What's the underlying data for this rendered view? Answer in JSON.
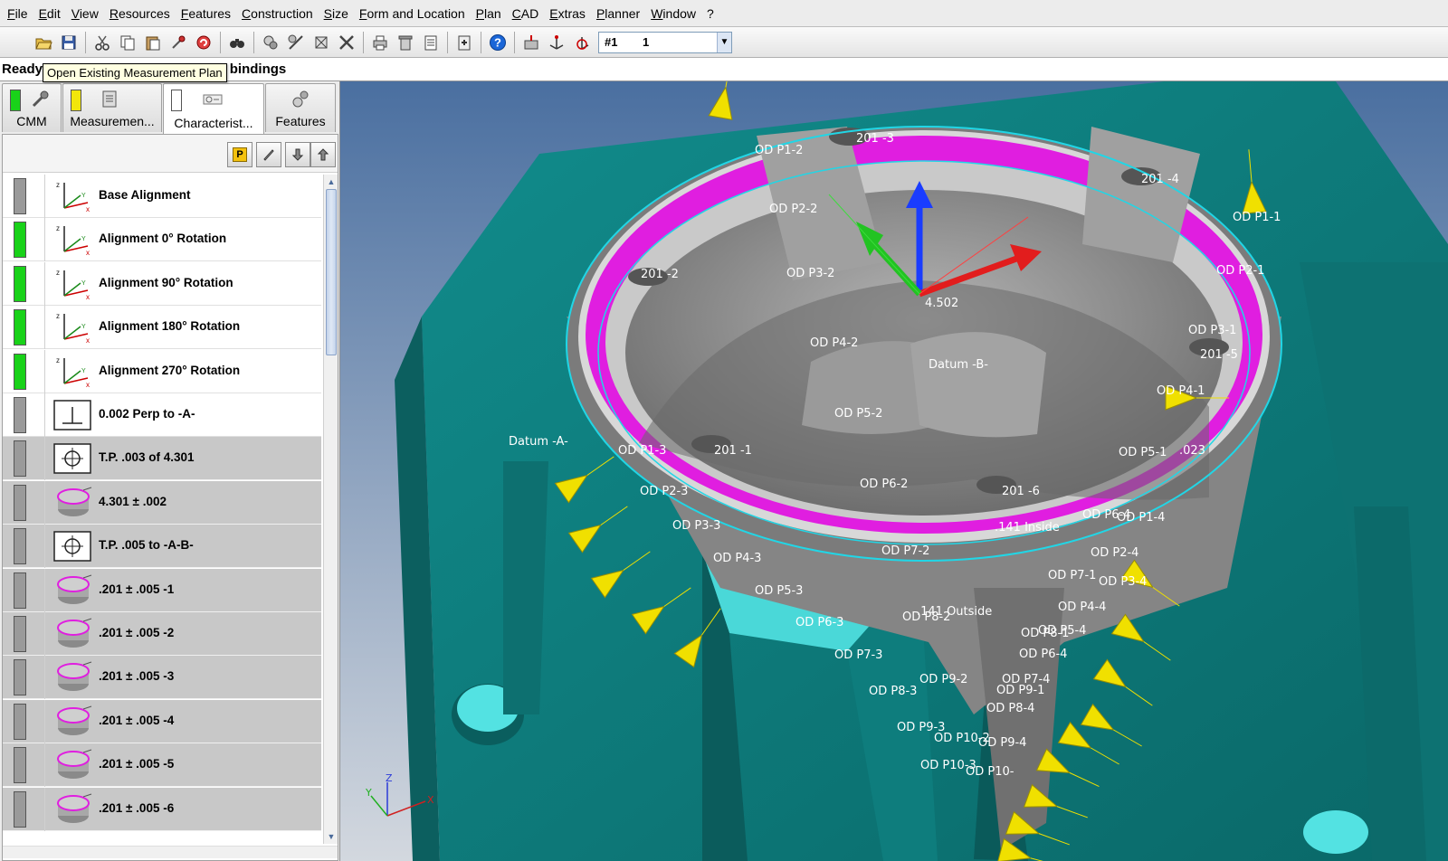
{
  "menu": [
    "File",
    "Edit",
    "View",
    "Resources",
    "Features",
    "Construction",
    "Size",
    "Form and Location",
    "Plan",
    "CAD",
    "Extras",
    "Planner",
    "Window",
    "?"
  ],
  "toolbar": {
    "icons": [
      "open-icon",
      "save-icon",
      "cut-icon",
      "copy-icon",
      "paste-icon",
      "probe-icon",
      "undo-icon",
      "find-icon",
      "feature-icon",
      "measure-icon",
      "construct-icon",
      "settings-icon",
      "print-icon",
      "delete-icon",
      "list-icon",
      "export-icon",
      "help-icon",
      "cmm-icon",
      "axis-icon",
      "rotate-icon"
    ],
    "plan_id": "#1",
    "plan_value": "1"
  },
  "status": {
    "text": "Ready  Make a selection in the plan bindings",
    "tooltip": "Open Existing Measurement Plan"
  },
  "tabs": [
    {
      "label": "CMM",
      "swatch": "#19d219"
    },
    {
      "label": "Measuremen...",
      "swatch": "#f2e60c"
    },
    {
      "label": "Characterist...",
      "swatch": "#ffffff"
    },
    {
      "label": "Features",
      "swatch": ""
    }
  ],
  "list_buttons": [
    "P",
    "pencil-icon",
    "arrow-down-icon",
    "arrow-up-icon"
  ],
  "characteristics": [
    {
      "label": "Base Alignment",
      "status": "#9a9a9a",
      "icon": "alignment-icon",
      "selected": false
    },
    {
      "label": "Alignment 0° Rotation",
      "status": "#19d219",
      "icon": "alignment-icon",
      "selected": false
    },
    {
      "label": "Alignment 90° Rotation",
      "status": "#19d219",
      "icon": "alignment-icon",
      "selected": false
    },
    {
      "label": "Alignment 180° Rotation",
      "status": "#19d219",
      "icon": "alignment-icon",
      "selected": false
    },
    {
      "label": "Alignment 270° Rotation",
      "status": "#19d219",
      "icon": "alignment-icon",
      "selected": false
    },
    {
      "label": "0.002 Perp to -A-",
      "status": "#9a9a9a",
      "icon": "perpendicularity-icon",
      "selected": false
    },
    {
      "label": "T.P. .003 of 4.301",
      "status": "#9a9a9a",
      "icon": "position-icon",
      "selected": true
    },
    {
      "label": "4.301 ± .002",
      "status": "#9a9a9a",
      "icon": "diameter-icon",
      "selected": true
    },
    {
      "label": "T.P. .005 to -A-B-",
      "status": "#9a9a9a",
      "icon": "position-icon",
      "selected": true
    },
    {
      "label": ".201 ± .005  -1",
      "status": "#9a9a9a",
      "icon": "diameter-icon",
      "selected": true
    },
    {
      "label": ".201 ± .005  -2",
      "status": "#9a9a9a",
      "icon": "diameter-icon",
      "selected": true
    },
    {
      "label": ".201 ± .005  -3",
      "status": "#9a9a9a",
      "icon": "diameter-icon",
      "selected": true
    },
    {
      "label": ".201 ± .005  -4",
      "status": "#9a9a9a",
      "icon": "diameter-icon",
      "selected": true
    },
    {
      "label": ".201 ± .005  -5",
      "status": "#9a9a9a",
      "icon": "diameter-icon",
      "selected": true
    },
    {
      "label": ".201 ± .005  -6",
      "status": "#9a9a9a",
      "icon": "diameter-icon",
      "selected": true
    }
  ],
  "viewport": {
    "colors": {
      "background_top": "#4a6fa0",
      "background_bottom": "#d3d8df",
      "fixture": "#0e7f7f",
      "part": "#8c8c8c",
      "magenta": "#e01ee0",
      "probe_cone": "#f0e000"
    },
    "labels": [
      "OD  P1-2",
      "201 -3",
      "201 -4",
      "OD  P1-1",
      "OD  P2-2",
      "201 -2",
      "OD  P3-2",
      "4.502",
      "OD  P2-1",
      "OD  P4-2",
      "OD  P3-1",
      "201 -5",
      "Datum -B-",
      "OD  P4-1",
      "OD  P5-2",
      "Datum -A-",
      "OD  P1-3",
      "201 -1",
      "OD  P5-1",
      ".023",
      "OD  P6-2",
      "201 -6",
      "OD  P2-3",
      "OD  P6-4",
      "OD  P1-4",
      ".141 Inside",
      "OD  P3-3",
      "OD  P7-2",
      "OD  P2-4",
      "OD  P4-3",
      "OD  P7-1",
      "OD  P3-4",
      "OD  P5-3",
      ".141 Outside",
      "OD  P8-2",
      "OD  P4-4",
      "OD  P6-3",
      "OD  P8-1",
      "OD  P5-4",
      "OD  P7-3",
      "OD  P6-4",
      "OD  P9-2",
      "OD  P7-4",
      "OD  P8-3",
      "OD  P9-1",
      "OD  P8-4",
      "OD  P9-3",
      "OD  P10-2",
      "OD  P9-4",
      "OD  P10-3",
      "OD  P10-"
    ],
    "axis": {
      "x": "X",
      "y": "Y",
      "z": "Z"
    }
  }
}
